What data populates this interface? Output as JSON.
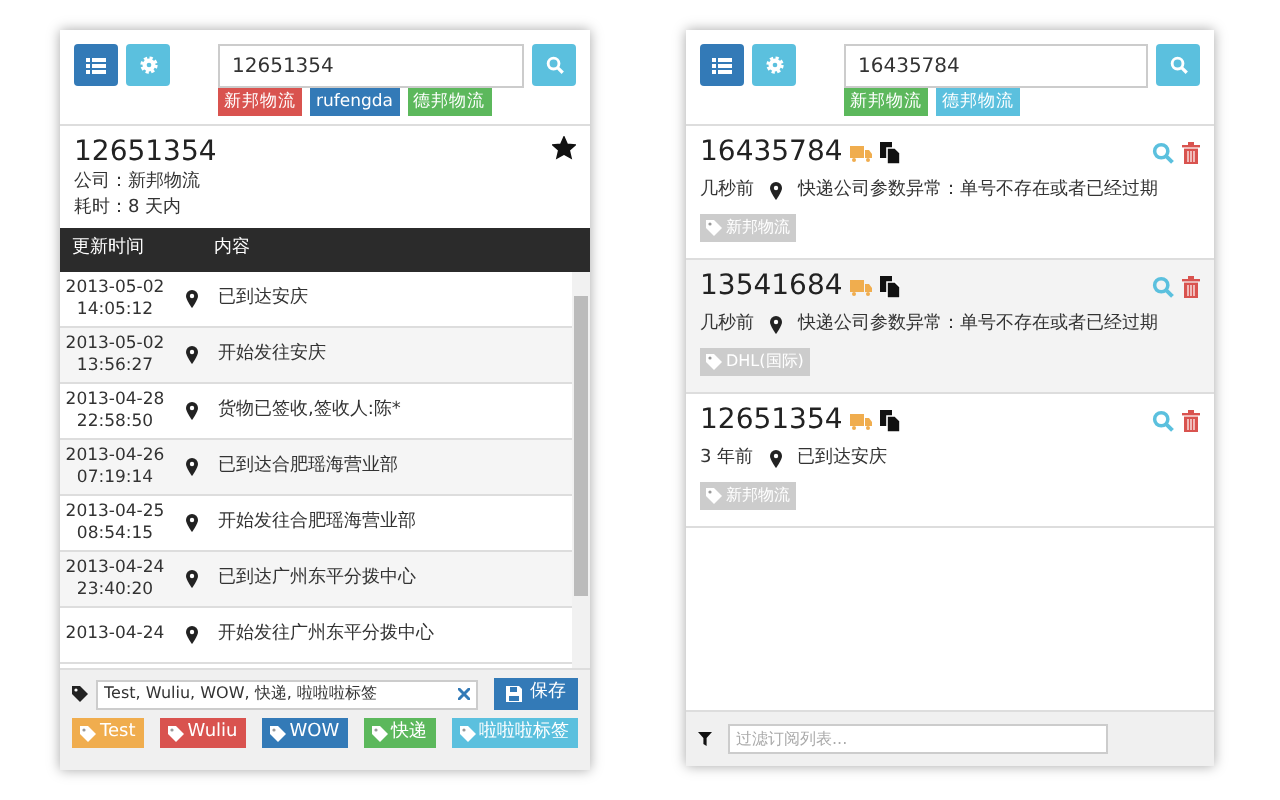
{
  "detail_panel": {
    "search": {
      "value": "12651354"
    },
    "companies": [
      {
        "label": "新邦物流",
        "color": "#d9534f"
      },
      {
        "label": "rufengda",
        "color": "#337ab7"
      },
      {
        "label": "德邦物流",
        "color": "#5cb85c"
      }
    ],
    "result": {
      "number": "12651354",
      "starred": true,
      "company": "公司：新邦物流",
      "duration": "耗时：8 天内"
    },
    "columns": [
      "更新时间",
      "内容"
    ],
    "rows": [
      {
        "date": "2013-05-02",
        "time": "14:05:12",
        "content": "已到达安庆"
      },
      {
        "date": "2013-05-02",
        "time": "13:56:27",
        "content": "开始发往安庆"
      },
      {
        "date": "2013-04-28",
        "time": "22:58:50",
        "content": "货物已签收,签收人:陈*"
      },
      {
        "date": "2013-04-26",
        "time": "07:19:14",
        "content": "已到达合肥瑶海营业部"
      },
      {
        "date": "2013-04-25",
        "time": "08:54:15",
        "content": "开始发往合肥瑶海营业部"
      },
      {
        "date": "2013-04-24",
        "time": "23:40:20",
        "content": "已到达广州东平分拨中心"
      },
      {
        "date": "2013-04-24",
        "content": "开始发往广州东平分拨中心"
      }
    ],
    "tag_input": {
      "value": "Test, Wuliu, WOW, 快递, 啦啦啦标签"
    },
    "save_button": "保存",
    "tags": [
      {
        "label": "Test",
        "color": "#f0ad4e"
      },
      {
        "label": "Wuliu",
        "color": "#d9534f"
      },
      {
        "label": "WOW",
        "color": "#337ab7"
      },
      {
        "label": "快递",
        "color": "#5cb85c"
      },
      {
        "label": "啦啦啦标签",
        "color": "#5bc0de"
      }
    ]
  },
  "list_panel": {
    "search": {
      "value": "16435784"
    },
    "companies": [
      {
        "label": "新邦物流",
        "color": "#5cb85c"
      },
      {
        "label": "德邦物流",
        "color": "#5bc0de"
      }
    ],
    "items": [
      {
        "number": "16435784",
        "time_ago": "几秒前",
        "status": "快递公司参数异常：单号不存在或者已经过期",
        "tag": "新邦物流",
        "selected": false
      },
      {
        "number": "13541684",
        "time_ago": "几秒前",
        "status": "快递公司参数异常：单号不存在或者已经过期",
        "tag": "DHL(国际)",
        "selected": true
      },
      {
        "number": "12651354",
        "time_ago": "3 年前",
        "status": "已到达安庆",
        "tag": "新邦物流",
        "selected": false
      }
    ],
    "filter": {
      "placeholder": "过滤订阅列表..."
    }
  }
}
